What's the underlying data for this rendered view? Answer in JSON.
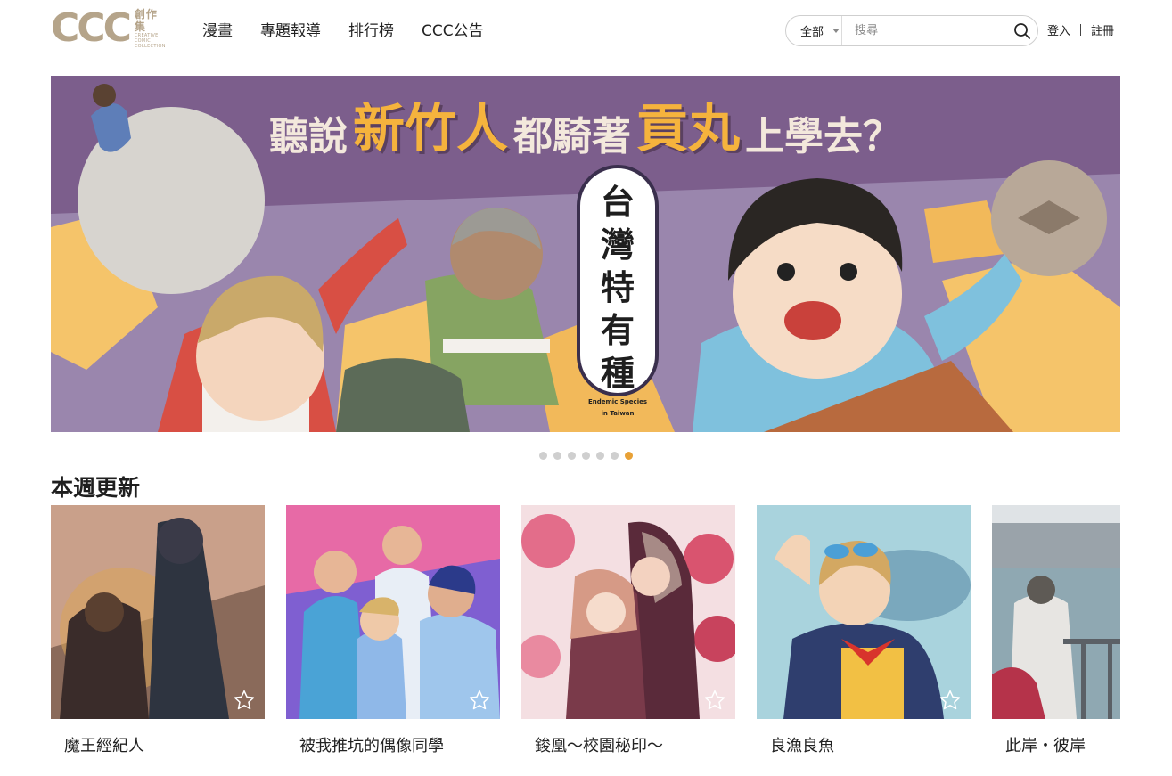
{
  "header": {
    "logo": {
      "mark": "CCC",
      "cn": "創作集",
      "en_line1": "CREATIVE COMIC",
      "en_line2": "COLLECTION"
    },
    "nav": [
      "漫畫",
      "專題報導",
      "排行榜",
      "CCC公告"
    ],
    "search": {
      "category": "全部",
      "placeholder": "搜尋"
    },
    "auth": {
      "login": "登入",
      "register": "註冊"
    }
  },
  "banner": {
    "headline": {
      "part1": "聽說",
      "part2": "新竹人",
      "part3": "都騎著",
      "part4": "貢丸",
      "part5": "上學去？"
    },
    "series_title_chars": [
      "台",
      "灣",
      "特",
      "有",
      "種"
    ],
    "series_en_line1": "Endemic Species",
    "series_en_line2": "in Taiwan",
    "colors": {
      "purple": "#7c5e8c",
      "orange": "#f5b33d",
      "cream": "#f3e8dc"
    }
  },
  "carousel": {
    "count": 7,
    "active_index": 6,
    "active_color": "#e8a136",
    "inactive_color": "#cfcfcf"
  },
  "weekly": {
    "title": "本週更新",
    "items": [
      {
        "title": "魔王經紀人"
      },
      {
        "title": "被我推坑的偶像同學"
      },
      {
        "title": "鋑凰～校園秘印～"
      },
      {
        "title": "良漁良魚"
      },
      {
        "title": "此岸・彼岸"
      }
    ]
  }
}
